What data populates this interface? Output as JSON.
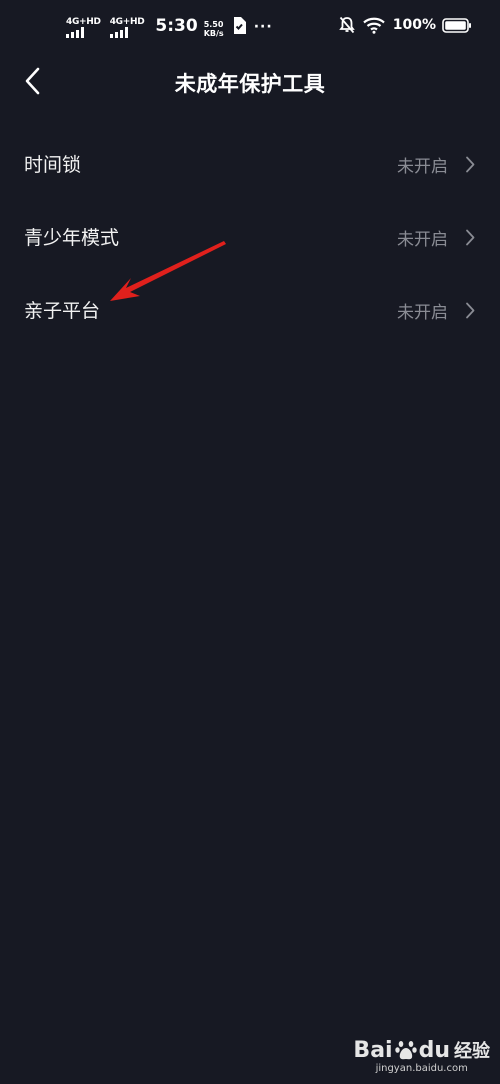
{
  "status_bar": {
    "network1": "4G+HD",
    "network2": "4G+HD",
    "time": "5:30",
    "speed_value": "5.50",
    "speed_unit": "KB/s",
    "more": "···",
    "battery": "100%",
    "icons": [
      "signal-icon",
      "sim-icon",
      "mute-bell-icon",
      "wifi-icon",
      "battery-icon"
    ]
  },
  "nav": {
    "title": "未成年保护工具",
    "back_icon": "chevron-left-icon"
  },
  "list": [
    {
      "label": "时间锁",
      "status": "未开启"
    },
    {
      "label": "青少年模式",
      "status": "未开启"
    },
    {
      "label": "亲子平台",
      "status": "未开启"
    }
  ],
  "annotation": {
    "color": "#e0201c"
  },
  "watermark": {
    "brand": "Bai",
    "brand2": "du",
    "sub": "经验",
    "url": "jingyan.baidu.com"
  },
  "colors": {
    "background": "#171923",
    "text_primary": "#f2f2f2",
    "text_secondary": "#8a8c94"
  }
}
